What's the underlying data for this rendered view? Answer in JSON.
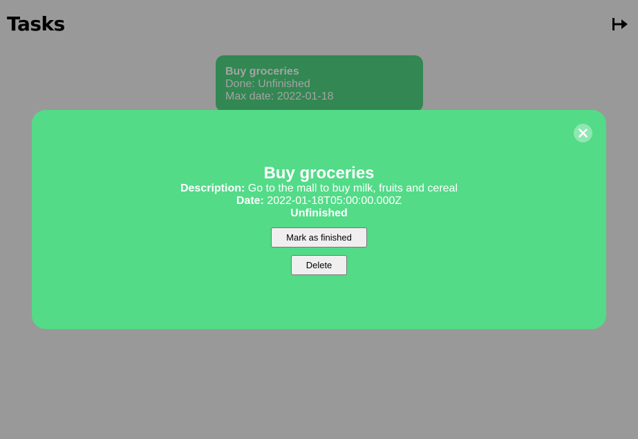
{
  "header": {
    "title": "Tasks",
    "logout_icon": "logout-arrow-icon"
  },
  "task_list": [
    {
      "title": "Buy groceries",
      "done_text": "Done: Unfinished",
      "max_date_text": "Max date: 2022-01-18"
    }
  ],
  "modal": {
    "title": "Buy groceries",
    "description_label": "Description:",
    "description_value": "Go to the mall to buy milk, fruits and cereal",
    "date_label": "Date:",
    "date_value": "2022-01-18T05:00:00.000Z",
    "status": "Unfinished",
    "mark_finished_label": "Mark as finished",
    "delete_label": "Delete",
    "close_icon": "close-icon"
  },
  "colors": {
    "background_overlay": "#999999",
    "card": "#328752",
    "modal": "#53db88",
    "modal_text": "#ffffff"
  }
}
